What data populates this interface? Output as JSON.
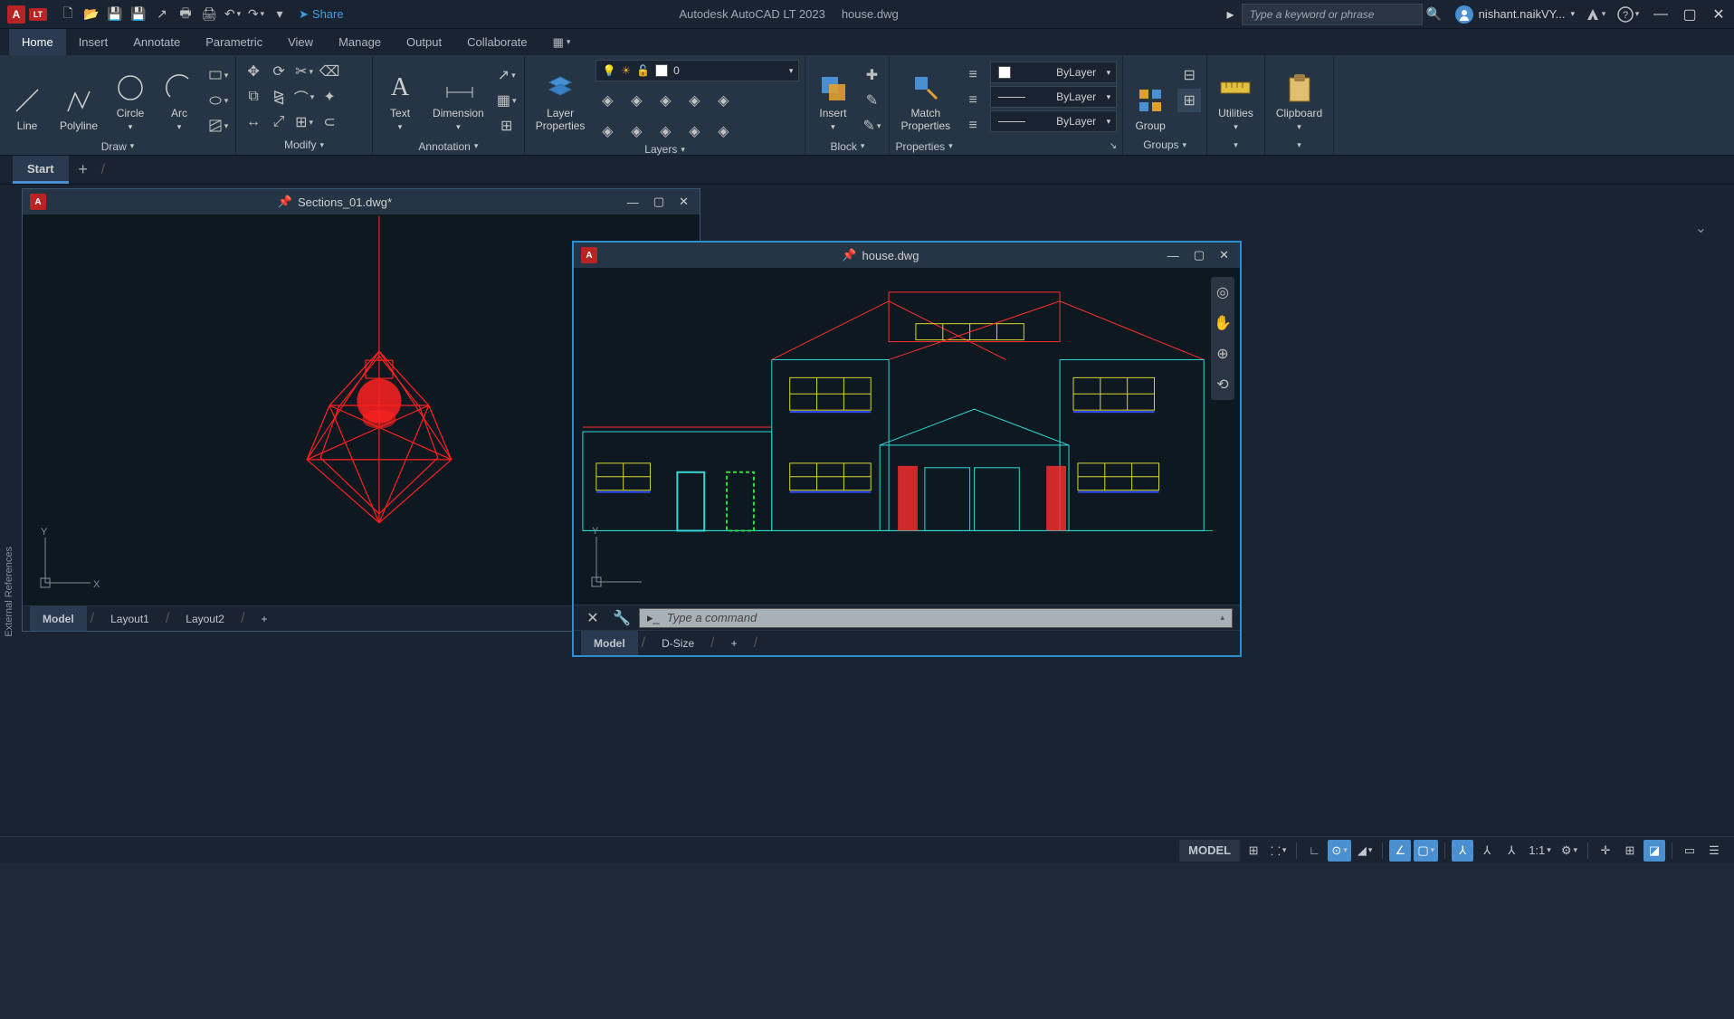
{
  "app": {
    "name": "Autodesk AutoCAD LT 2023",
    "doc": "house.dwg",
    "lt": "LT",
    "a": "A"
  },
  "search_placeholder": "Type a keyword or phrase",
  "user": {
    "name": "nishant.naikVY..."
  },
  "share_label": "Share",
  "ribbon_tabs": [
    "Home",
    "Insert",
    "Annotate",
    "Parametric",
    "View",
    "Manage",
    "Output",
    "Collaborate"
  ],
  "panels": {
    "draw": {
      "title": "Draw",
      "line": "Line",
      "polyline": "Polyline",
      "circle": "Circle",
      "arc": "Arc"
    },
    "modify": {
      "title": "Modify"
    },
    "annotation": {
      "title": "Annotation",
      "text": "Text",
      "dimension": "Dimension"
    },
    "layers": {
      "title": "Layers",
      "props": "Layer\nProperties",
      "combo_value": "0"
    },
    "block": {
      "title": "Block",
      "insert": "Insert"
    },
    "properties": {
      "title": "Properties",
      "match": "Match\nProperties",
      "color": "ByLayer",
      "lw": "ByLayer",
      "lt": "ByLayer"
    },
    "groups": {
      "title": "Groups",
      "group": "Group"
    },
    "utilities": {
      "title": "Utilities"
    },
    "clipboard": {
      "title": "Clipboard"
    }
  },
  "file_tabs": {
    "start": "Start"
  },
  "windows": {
    "sections": {
      "title": "Sections_01.dwg*",
      "layouts": [
        "Model",
        "Layout1",
        "Layout2"
      ]
    },
    "house": {
      "title": "house.dwg",
      "layouts": [
        "Model",
        "D-Size"
      ],
      "cmd_placeholder": "Type a command"
    }
  },
  "side_panel": "External References",
  "statusbar": {
    "model": "MODEL",
    "scale": "1:1"
  }
}
